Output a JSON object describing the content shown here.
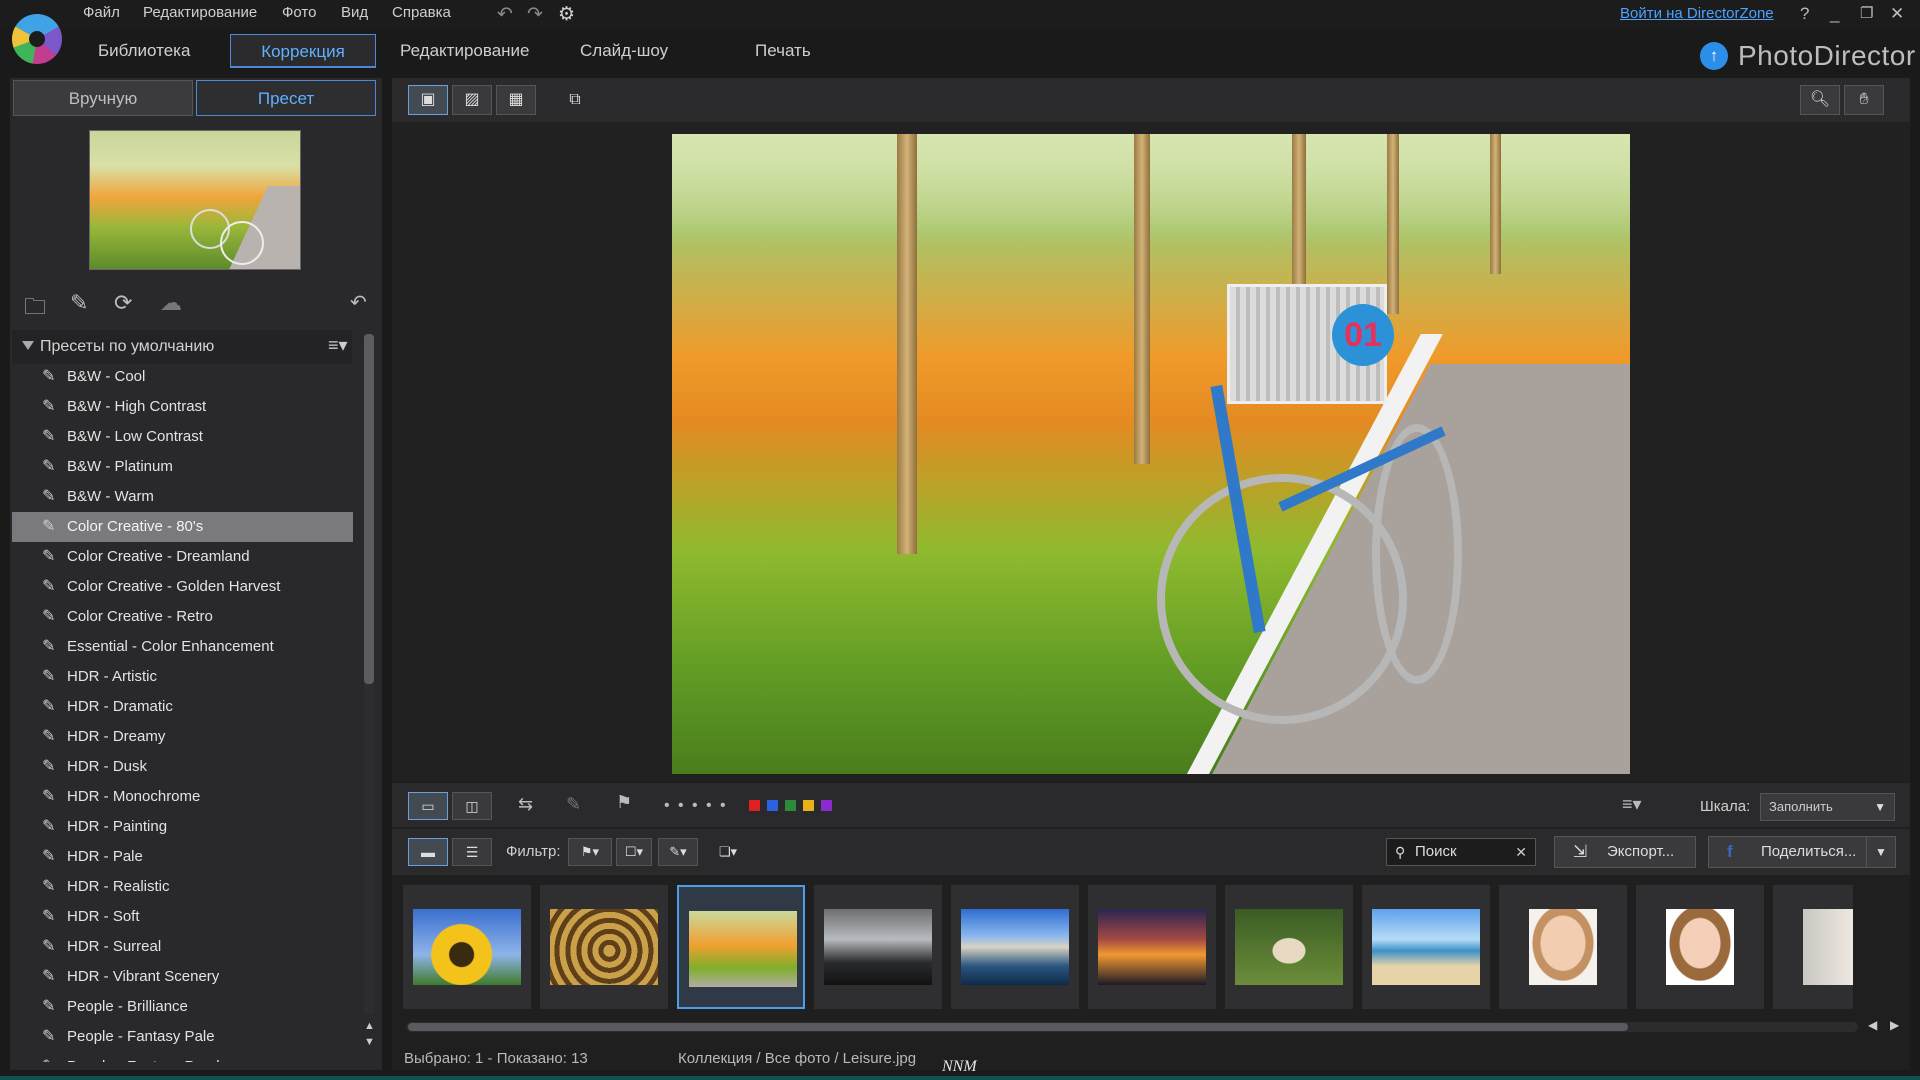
{
  "menubar": {
    "items": [
      "Файл",
      "Редактирование",
      "Фото",
      "Вид",
      "Справка"
    ],
    "link": "Войти на DirectorZone",
    "help": "?"
  },
  "modules": {
    "tabs": [
      "Библиотека",
      "Коррекция",
      "Редактирование",
      "Слайд-шоу",
      "Печать"
    ],
    "active": "Коррекция",
    "brand": "PhotoDirector"
  },
  "left_panel": {
    "tabs": [
      "Вручную",
      "Пресет"
    ],
    "active_tab": "Пресет",
    "preset_group": "Пресеты по умолчанию",
    "presets": [
      "B&W - Cool",
      "B&W - High Contrast",
      "B&W - Low Contrast",
      "B&W - Platinum",
      "B&W - Warm",
      "Color Creative - 80's",
      "Color Creative - Dreamland",
      "Color Creative - Golden Harvest",
      "Color Creative - Retro",
      "Essential - Color Enhancement",
      "HDR - Artistic",
      "HDR - Dramatic",
      "HDR - Dreamy",
      "HDR - Dusk",
      "HDR - Monochrome",
      "HDR - Painting",
      "HDR - Pale",
      "HDR - Realistic",
      "HDR - Soft",
      "HDR - Surreal",
      "HDR - Vibrant Scenery",
      "People - Brilliance",
      "People - Fantasy Pale",
      "People - Fantasy Purple"
    ],
    "selected_preset": "Color Creative - 80's"
  },
  "filmstrip_bar": {
    "scale_label": "Шкала:",
    "scale_value": "Заполнить",
    "filter_label": "Фильтр:",
    "search_placeholder": "Поиск",
    "export_label": "Экспорт...",
    "share_label": "Поделиться...",
    "color_labels": [
      "#e02020",
      "#2a63e0",
      "#2c8a3a",
      "#e8b21a",
      "#8a2ad0"
    ]
  },
  "status": {
    "selection": "Выбрано: 1 - Показано: 13",
    "path": "Коллекция / Все фото / Leisure.jpg",
    "watermark": "NNM"
  }
}
